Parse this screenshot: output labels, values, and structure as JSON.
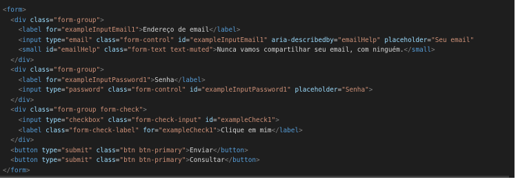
{
  "colors": {
    "background": "#1e1e1e",
    "tag": "#569cd6",
    "attribute": "#9cdcfe",
    "string": "#ce9178",
    "text": "#d4d4d4",
    "punctuation": "#808080"
  },
  "scrollbar": {
    "thumb_fraction": 0.99
  },
  "lines": [
    {
      "indent": 0,
      "tokens": [
        [
          "punct",
          "<"
        ],
        [
          "tag",
          "form"
        ],
        [
          "punct",
          ">"
        ]
      ]
    },
    {
      "indent": 1,
      "tokens": [
        [
          "punct",
          "<"
        ],
        [
          "tag",
          "div"
        ],
        [
          "text",
          " "
        ],
        [
          "attr",
          "class"
        ],
        [
          "text",
          "="
        ],
        [
          "str",
          "\"form-group\""
        ],
        [
          "punct",
          ">"
        ]
      ]
    },
    {
      "indent": 2,
      "tokens": [
        [
          "punct",
          "<"
        ],
        [
          "tag",
          "label"
        ],
        [
          "text",
          " "
        ],
        [
          "attr",
          "for"
        ],
        [
          "text",
          "="
        ],
        [
          "str",
          "\"exampleInputEmail1\""
        ],
        [
          "punct",
          ">"
        ],
        [
          "text",
          "Endereço de email"
        ],
        [
          "punct",
          "</"
        ],
        [
          "tag",
          "label"
        ],
        [
          "punct",
          ">"
        ]
      ]
    },
    {
      "indent": 2,
      "tokens": [
        [
          "punct",
          "<"
        ],
        [
          "tag",
          "input"
        ],
        [
          "text",
          " "
        ],
        [
          "attr",
          "type"
        ],
        [
          "text",
          "="
        ],
        [
          "str",
          "\"email\""
        ],
        [
          "text",
          " "
        ],
        [
          "attr",
          "class"
        ],
        [
          "text",
          "="
        ],
        [
          "str",
          "\"form-control\""
        ],
        [
          "text",
          " "
        ],
        [
          "attr",
          "id"
        ],
        [
          "text",
          "="
        ],
        [
          "str",
          "\"exampleInputEmail1\""
        ],
        [
          "text",
          " "
        ],
        [
          "attr",
          "aria-describedby"
        ],
        [
          "text",
          "="
        ],
        [
          "str",
          "\"emailHelp\""
        ],
        [
          "text",
          " "
        ],
        [
          "attr",
          "placeholder"
        ],
        [
          "text",
          "="
        ],
        [
          "str",
          "\"Seu email\""
        ]
      ]
    },
    {
      "indent": 2,
      "tokens": [
        [
          "punct",
          "<"
        ],
        [
          "tag",
          "small"
        ],
        [
          "text",
          " "
        ],
        [
          "attr",
          "id"
        ],
        [
          "text",
          "="
        ],
        [
          "str",
          "\"emailHelp\""
        ],
        [
          "text",
          " "
        ],
        [
          "attr",
          "class"
        ],
        [
          "text",
          "="
        ],
        [
          "str",
          "\"form-text text-muted\""
        ],
        [
          "punct",
          ">"
        ],
        [
          "text",
          "Nunca vamos compartilhar seu email, com ninguém."
        ],
        [
          "punct",
          "</"
        ],
        [
          "tag",
          "small"
        ],
        [
          "punct",
          ">"
        ]
      ]
    },
    {
      "indent": 1,
      "tokens": [
        [
          "punct",
          "</"
        ],
        [
          "tag",
          "div"
        ],
        [
          "punct",
          ">"
        ]
      ]
    },
    {
      "indent": 1,
      "tokens": [
        [
          "punct",
          "<"
        ],
        [
          "tag",
          "div"
        ],
        [
          "text",
          " "
        ],
        [
          "attr",
          "class"
        ],
        [
          "text",
          "="
        ],
        [
          "str",
          "\"form-group\""
        ],
        [
          "punct",
          ">"
        ]
      ]
    },
    {
      "indent": 2,
      "tokens": [
        [
          "punct",
          "<"
        ],
        [
          "tag",
          "label"
        ],
        [
          "text",
          " "
        ],
        [
          "attr",
          "for"
        ],
        [
          "text",
          "="
        ],
        [
          "str",
          "\"exampleInputPassword1\""
        ],
        [
          "punct",
          ">"
        ],
        [
          "text",
          "Senha"
        ],
        [
          "punct",
          "</"
        ],
        [
          "tag",
          "label"
        ],
        [
          "punct",
          ">"
        ]
      ]
    },
    {
      "indent": 2,
      "tokens": [
        [
          "punct",
          "<"
        ],
        [
          "tag",
          "input"
        ],
        [
          "text",
          " "
        ],
        [
          "attr",
          "type"
        ],
        [
          "text",
          "="
        ],
        [
          "str",
          "\"password\""
        ],
        [
          "text",
          " "
        ],
        [
          "attr",
          "class"
        ],
        [
          "text",
          "="
        ],
        [
          "str",
          "\"form-control\""
        ],
        [
          "text",
          " "
        ],
        [
          "attr",
          "id"
        ],
        [
          "text",
          "="
        ],
        [
          "str",
          "\"exampleInputPassword1\""
        ],
        [
          "text",
          " "
        ],
        [
          "attr",
          "placeholder"
        ],
        [
          "text",
          "="
        ],
        [
          "str",
          "\"Senha\""
        ],
        [
          "punct",
          ">"
        ]
      ]
    },
    {
      "indent": 1,
      "tokens": [
        [
          "punct",
          "</"
        ],
        [
          "tag",
          "div"
        ],
        [
          "punct",
          ">"
        ]
      ]
    },
    {
      "indent": 1,
      "tokens": [
        [
          "punct",
          "<"
        ],
        [
          "tag",
          "div"
        ],
        [
          "text",
          " "
        ],
        [
          "attr",
          "class"
        ],
        [
          "text",
          "="
        ],
        [
          "str",
          "\"form-group form-check\""
        ],
        [
          "punct",
          ">"
        ]
      ]
    },
    {
      "indent": 2,
      "tokens": [
        [
          "punct",
          "<"
        ],
        [
          "tag",
          "input"
        ],
        [
          "text",
          " "
        ],
        [
          "attr",
          "type"
        ],
        [
          "text",
          "="
        ],
        [
          "str",
          "\"checkbox\""
        ],
        [
          "text",
          " "
        ],
        [
          "attr",
          "class"
        ],
        [
          "text",
          "="
        ],
        [
          "str",
          "\"form-check-input\""
        ],
        [
          "text",
          " "
        ],
        [
          "attr",
          "id"
        ],
        [
          "text",
          "="
        ],
        [
          "str",
          "\"exampleCheck1\""
        ],
        [
          "punct",
          ">"
        ]
      ]
    },
    {
      "indent": 2,
      "tokens": [
        [
          "punct",
          "<"
        ],
        [
          "tag",
          "label"
        ],
        [
          "text",
          " "
        ],
        [
          "attr",
          "class"
        ],
        [
          "text",
          "="
        ],
        [
          "str",
          "\"form-check-label\""
        ],
        [
          "text",
          " "
        ],
        [
          "attr",
          "for"
        ],
        [
          "text",
          "="
        ],
        [
          "str",
          "\"exampleCheck1\""
        ],
        [
          "punct",
          ">"
        ],
        [
          "text",
          "Clique em mim"
        ],
        [
          "punct",
          "</"
        ],
        [
          "tag",
          "label"
        ],
        [
          "punct",
          ">"
        ]
      ]
    },
    {
      "indent": 1,
      "tokens": [
        [
          "punct",
          "</"
        ],
        [
          "tag",
          "div"
        ],
        [
          "punct",
          ">"
        ]
      ]
    },
    {
      "indent": 1,
      "tokens": [
        [
          "punct",
          "<"
        ],
        [
          "tag",
          "button"
        ],
        [
          "text",
          " "
        ],
        [
          "attr",
          "type"
        ],
        [
          "text",
          "="
        ],
        [
          "str",
          "\"submit\""
        ],
        [
          "text",
          " "
        ],
        [
          "attr",
          "class"
        ],
        [
          "text",
          "="
        ],
        [
          "str",
          "\"btn btn-primary\""
        ],
        [
          "punct",
          ">"
        ],
        [
          "text",
          "Enviar"
        ],
        [
          "punct",
          "</"
        ],
        [
          "tag",
          "button"
        ],
        [
          "punct",
          ">"
        ]
      ]
    },
    {
      "indent": 1,
      "tokens": [
        [
          "punct",
          "<"
        ],
        [
          "tag",
          "button"
        ],
        [
          "text",
          " "
        ],
        [
          "attr",
          "type"
        ],
        [
          "text",
          "="
        ],
        [
          "str",
          "\"submit\""
        ],
        [
          "text",
          " "
        ],
        [
          "attr",
          "class"
        ],
        [
          "text",
          "="
        ],
        [
          "str",
          "\"btn btn-primary\""
        ],
        [
          "punct",
          ">"
        ],
        [
          "text",
          "Consultar"
        ],
        [
          "punct",
          "</"
        ],
        [
          "tag",
          "button"
        ],
        [
          "punct",
          ">"
        ]
      ]
    },
    {
      "indent": 0,
      "tokens": [
        [
          "punct",
          "</"
        ],
        [
          "tag",
          "form"
        ],
        [
          "punct",
          ">"
        ]
      ]
    }
  ]
}
